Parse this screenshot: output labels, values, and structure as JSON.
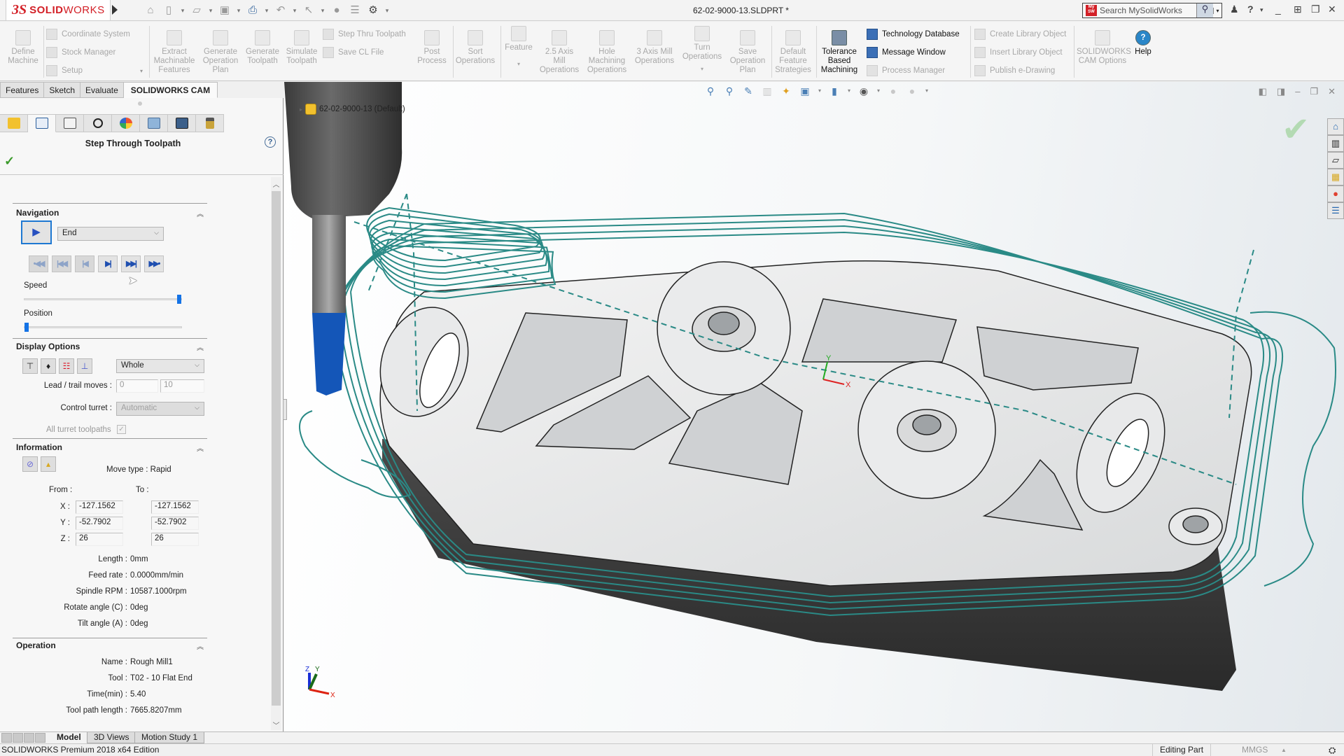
{
  "app": {
    "brand_prefix": "3S",
    "brand_bold": "SOLID",
    "brand_light": "WORKS",
    "document_title": "62-02-9000-13.SLDPRT *",
    "search_placeholder": "Search MySolidWorks",
    "mysw_badge": "My SW",
    "quick_access_icons": [
      "home-icon",
      "new-document-icon",
      "open-icon",
      "save-icon",
      "print-icon",
      "undo-icon",
      "select-icon",
      "rebuild-icon",
      "file-properties-icon",
      "options-icon"
    ],
    "title_controls": {
      "user": "user-icon",
      "help": "?",
      "minimize": "_",
      "fit": "⊞",
      "restore": "❐",
      "close": "✕"
    }
  },
  "ribbon": {
    "large_buttons": [
      {
        "id": "define-machine",
        "label": "Define\nMachine",
        "enabled": false
      },
      {
        "id": "extract-machinable-features",
        "label": "Extract\nMachinable\nFeatures",
        "enabled": false
      },
      {
        "id": "generate-operation-plan",
        "label": "Generate\nOperation\nPlan",
        "enabled": false
      },
      {
        "id": "generate-toolpath",
        "label": "Generate\nToolpath",
        "enabled": false
      },
      {
        "id": "simulate-toolpath",
        "label": "Simulate\nToolpath",
        "enabled": false
      },
      {
        "id": "post-process",
        "label": "Post\nProcess",
        "enabled": false
      },
      {
        "id": "sort-operations",
        "label": "Sort\nOperations",
        "enabled": false
      },
      {
        "id": "feature",
        "label": "Feature",
        "enabled": false
      },
      {
        "id": "2-5-axis-mill-operations",
        "label": "2.5 Axis\nMill\nOperations",
        "enabled": false
      },
      {
        "id": "hole-machining-operations",
        "label": "Hole\nMachining\nOperations",
        "enabled": false
      },
      {
        "id": "3-axis-mill-operations",
        "label": "3 Axis Mill\nOperations",
        "enabled": false
      },
      {
        "id": "turn-operations",
        "label": "Turn\nOperations",
        "enabled": false
      },
      {
        "id": "save-operation-plan",
        "label": "Save\nOperation\nPlan",
        "enabled": false
      },
      {
        "id": "default-feature-strategies",
        "label": "Default\nFeature\nStrategies",
        "enabled": false
      },
      {
        "id": "tolerance-based-machining",
        "label": "Tolerance\nBased\nMachining",
        "enabled": true
      },
      {
        "id": "solidworks-cam-options",
        "label": "SOLIDWORKS\nCAM Options",
        "enabled": false
      },
      {
        "id": "help",
        "label": "Help",
        "enabled": true
      }
    ],
    "small_buttons": [
      {
        "id": "coordinate-system",
        "label": "Coordinate System",
        "enabled": false
      },
      {
        "id": "stock-manager",
        "label": "Stock Manager",
        "enabled": false
      },
      {
        "id": "setup",
        "label": "Setup",
        "enabled": false
      },
      {
        "id": "step-thru-toolpath",
        "label": "Step Thru Toolpath",
        "enabled": false
      },
      {
        "id": "save-cl-file",
        "label": "Save CL File",
        "enabled": false
      },
      {
        "id": "technology-database",
        "label": "Technology Database",
        "enabled": true
      },
      {
        "id": "message-window",
        "label": "Message Window",
        "enabled": true
      },
      {
        "id": "process-manager",
        "label": "Process Manager",
        "enabled": false
      },
      {
        "id": "create-library-object",
        "label": "Create Library Object",
        "enabled": false
      },
      {
        "id": "insert-library-object",
        "label": "Insert Library Object",
        "enabled": false
      },
      {
        "id": "publish-e-drawing",
        "label": "Publish e-Drawing",
        "enabled": false
      }
    ]
  },
  "command_tabs": [
    "Features",
    "Sketch",
    "Evaluate",
    "SOLIDWORKS CAM"
  ],
  "command_tabs_active": "SOLIDWORKS CAM",
  "manager_tabs": [
    "feature-manager",
    "solidworks-cam-feature-tree",
    "solidworks-cam-operation-tree",
    "dimxpert-manager",
    "display-manager",
    "cam-tree",
    "tool-tree",
    "tool-library"
  ],
  "property_manager": {
    "title": "Step Through Toolpath",
    "help": "?",
    "ok": "✓",
    "navigation": {
      "title": "Navigation",
      "play": "▶",
      "mode": "End",
      "step_buttons": [
        {
          "id": "go-to-start",
          "glyph": "•◀◀",
          "enabled": false
        },
        {
          "id": "previous-operation",
          "glyph": "|◀◀",
          "enabled": false
        },
        {
          "id": "step-back",
          "glyph": "|◀",
          "enabled": false
        },
        {
          "id": "step-forward",
          "glyph": "▶|",
          "enabled": true
        },
        {
          "id": "next-operation",
          "glyph": "▶▶|",
          "enabled": true
        },
        {
          "id": "go-to-end",
          "glyph": "▶▶•",
          "enabled": true
        }
      ],
      "speed_label": "Speed",
      "speed_value": 1.0,
      "position_label": "Position",
      "position_value": 0.0
    },
    "display_options": {
      "title": "Display Options",
      "icons": [
        "tool-display-icon",
        "holder-display-icon",
        "toolpath-display-icon",
        "rapid-moves-icon"
      ],
      "scope": "Whole",
      "lead_trail_label": "Lead / trail moves :",
      "lead_value": "0",
      "trail_value": "10",
      "control_turret_label": "Control turret :",
      "control_turret_value": "Automatic",
      "all_turret_label": "All turret toolpaths",
      "all_turret_checked": true
    },
    "information": {
      "title": "Information",
      "move_type": "Move type : Rapid",
      "from_label": "From :",
      "to_label": "To :",
      "x_label": "X :",
      "y_label": "Y :",
      "z_label": "Z :",
      "from": {
        "x": "-127.1562",
        "y": "-52.7902",
        "z": "26"
      },
      "to": {
        "x": "-127.1562",
        "y": "-52.7902",
        "z": "26"
      },
      "rows": [
        {
          "label": "Length :",
          "value": "0mm"
        },
        {
          "label": "Feed rate :",
          "value": "0.0000mm/min"
        },
        {
          "label": "Spindle RPM :",
          "value": "10587.1000rpm"
        },
        {
          "label": "Rotate angle (C) :",
          "value": "0deg"
        },
        {
          "label": "Tilt angle (A) :",
          "value": "0deg"
        }
      ]
    },
    "operation": {
      "title": "Operation",
      "rows": [
        {
          "label": "Name :",
          "value": "Rough Mill1"
        },
        {
          "label": "Tool :",
          "value": "T02 - 10 Flat End"
        },
        {
          "label": "Time(min) :",
          "value": "5.40"
        },
        {
          "label": "Tool path length :",
          "value": "7665.8207mm"
        }
      ]
    }
  },
  "viewport": {
    "tree_root": "62-02-9000-13  (Default)",
    "hud_icons": [
      "zoom-to-fit-icon",
      "zoom-to-area-icon",
      "previous-view-icon",
      "section-view-icon",
      "dynamic-annotation-icon",
      "view-orientation-icon",
      "display-style-icon",
      "hide-show-items-icon",
      "edit-appearance-icon",
      "apply-scene-icon"
    ],
    "toolpath_color": "#2a8a86",
    "tool_color": "#1456b8",
    "triad": {
      "x": "X",
      "y": "Y",
      "z": "Z"
    }
  },
  "task_pane": [
    "solidworks-resources-icon",
    "design-library-icon",
    "file-explorer-icon",
    "view-palette-icon",
    "appearances-icon",
    "custom-properties-icon"
  ],
  "bottom_tabs": [
    "Model",
    "3D Views",
    "Motion Study 1"
  ],
  "bottom_tabs_active": "Model",
  "status_bar": {
    "edition": "SOLIDWORKS Premium 2018 x64 Edition",
    "mode": "Editing Part",
    "units": "MMGS",
    "units_caret": "▲"
  }
}
